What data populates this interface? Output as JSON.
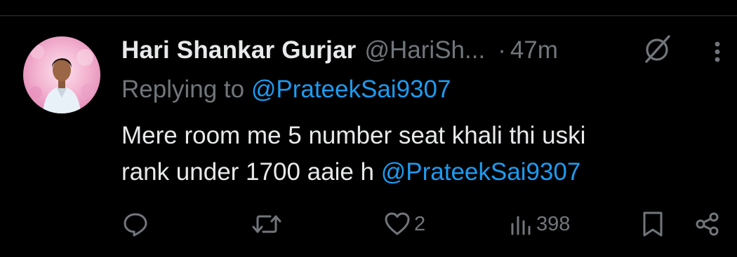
{
  "tweet": {
    "author": {
      "display_name": "Hari Shankar Gurjar",
      "handle": "@HariSh...",
      "avatar_icon": "user-avatar-photo"
    },
    "separator": "·",
    "timestamp": "47m",
    "replying_prefix": "Replying to ",
    "replying_to": "@PrateekSai9307",
    "text_line_1": "Mere room me 5 number seat khali thi uski",
    "text_line_2_prefix": "rank under 1700 aaie h ",
    "text_mention": "@PrateekSai9307",
    "header_icons": [
      "grok-icon",
      "more-vertical-icon"
    ]
  },
  "actions": {
    "reply": {
      "icon": "reply-icon",
      "count": ""
    },
    "repost": {
      "icon": "repost-icon",
      "count": ""
    },
    "like": {
      "icon": "heart-icon",
      "count": "2"
    },
    "views": {
      "icon": "views-chart-icon",
      "count": "398"
    },
    "bookmark": {
      "icon": "bookmark-icon"
    },
    "share": {
      "icon": "share-icon"
    }
  },
  "colors": {
    "background": "#000000",
    "text_primary": "#e7e9ea",
    "text_secondary": "#71767b",
    "accent_link": "#1d9bf0",
    "divider": "#2f3336"
  }
}
